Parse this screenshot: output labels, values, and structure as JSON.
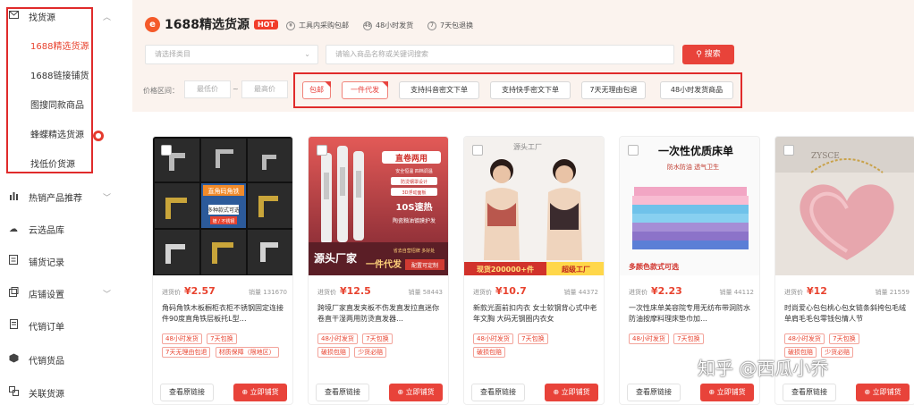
{
  "sidebar": {
    "group_title": "找货源",
    "sub_items": [
      "1688精选货源",
      "1688链接铺货",
      "图搜同款商品",
      "蜂蝶精选货源",
      "找低价货源"
    ],
    "badge": "●",
    "items": [
      {
        "label": "热销产品推荐",
        "icon": "fire-icon"
      },
      {
        "label": "云选品库",
        "icon": "cloud-icon"
      },
      {
        "label": "铺货记录",
        "icon": "record-icon"
      },
      {
        "label": "店铺设置",
        "icon": "store-settings-icon"
      },
      {
        "label": "代销订单",
        "icon": "order-icon"
      },
      {
        "label": "代销货品",
        "icon": "goods-icon"
      },
      {
        "label": "关联货源",
        "icon": "link-icon"
      }
    ]
  },
  "header": {
    "logo_badge": "e",
    "brand": "1688精选货源",
    "hot": "HOT",
    "features": [
      "工具内采购包邮",
      "48小时发货",
      "7天包退换"
    ],
    "feature_icons": [
      "¥",
      "48",
      "7"
    ]
  },
  "search": {
    "category_placeholder": "请选择类目",
    "keyword_placeholder": "请输入商品名称或关键词搜索",
    "button": "搜索"
  },
  "filters": {
    "price_label": "价格区间：",
    "min_placeholder": "最低价",
    "tilde": "~",
    "max_placeholder": "最高价",
    "tags": [
      "包邮",
      "一件代发",
      "支持抖音密文下单",
      "支持快手密文下单",
      "7天无理由包退",
      "48小时发货商品"
    ]
  },
  "products": [
    {
      "price_label": "进货价",
      "price": "¥2.57",
      "sales": "销量 131670",
      "title": "角码角铁木板橱柜衣柜不锈钢固定连接件90度直角铁层板托L型…",
      "tags": [
        "48小时发货",
        "7天包换",
        "7天无理由包退",
        "材质保障（限地区）"
      ],
      "img_text": [
        "直角码角铁",
        "多种款式可选"
      ],
      "img_badge": "镀 / 不锈钢"
    },
    {
      "price_label": "进货价",
      "price": "¥12.5",
      "sales": "销量 58443",
      "title": "跨境厂家直发夹板不伤发直发拉直迷你卷直干湿两用防烫直发器…",
      "tags": [
        "48小时发货",
        "7天包换",
        "破损包赔",
        "少货必赔"
      ],
      "img_text": [
        "直卷两用",
        "安全恒温  四档调温",
        "防烫钢罩设计",
        "3D浮动面板",
        "10S速热",
        "陶瓷釉油镀膜护发",
        "源头厂家",
        "一件代发",
        "配置可定制",
        "省去自营招牌 多好处"
      ]
    },
    {
      "price_label": "进货价",
      "price": "¥10.7",
      "sales": "销量 44372",
      "title": "新款光面前扣内衣 女士软钢背心式中老年文胸 大码无钢圈内衣女",
      "tags": [
        "48小时发货",
        "7天包换",
        "破损包赔"
      ],
      "img_text": [
        "源头工厂",
        "现货200000+件",
        "超级工厂"
      ]
    },
    {
      "price_label": "进货价",
      "price": "¥2.23",
      "sales": "销量 44112",
      "title": "一次性床单美容院专用无纺布带洞防水防油按摩料理床垫巾加…",
      "tags": [
        "48小时发货",
        "7天包换"
      ],
      "img_text": [
        "一次性优质床单",
        "防水防油  透气卫生",
        "多颜色款式可选"
      ]
    },
    {
      "price_label": "进货价",
      "price": "¥12",
      "sales": "销量 21559",
      "title": "时尚爱心包包桃心包女链条斜挎包毛绒单肩毛毛包零钱包情人节",
      "tags": [
        "48小时发货",
        "7天包换",
        "破损包赔",
        "少货必赔"
      ],
      "img_text": [
        "ZYSCE"
      ]
    }
  ],
  "card_buttons": {
    "view": "查看原链接",
    "go": "立即铺货"
  },
  "watermark": "知乎 @西瓜小乔",
  "colors": {
    "accent": "#e8433a",
    "header_bg": "#fbf3ee",
    "highlight_box": "#e02b2b"
  }
}
